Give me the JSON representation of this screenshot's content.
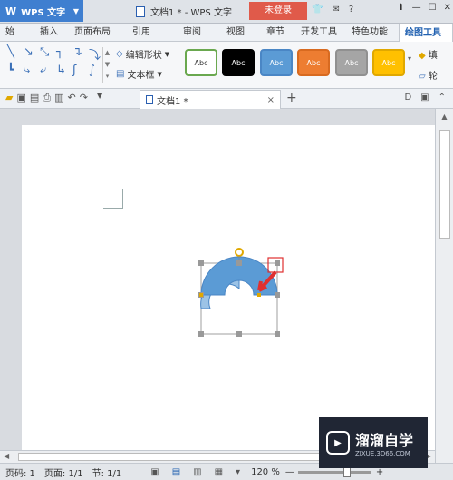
{
  "title_bar": {
    "app_name": "WPS 文字",
    "document_title": "文档1 * - WPS 文字",
    "login_label": "未登录"
  },
  "tabs": [
    "始",
    "插入",
    "页面布局",
    "引用",
    "审阅",
    "视图",
    "章节",
    "开发工具",
    "特色功能",
    "绘图工具"
  ],
  "active_tab": "绘图工具",
  "ribbon": {
    "edit_shape": "编辑形状",
    "text_box": "文本框",
    "style_label": "Abc",
    "styles": [
      {
        "bg": "#ffffff",
        "fg": "#333333",
        "border": "#6aa84f"
      },
      {
        "bg": "#000000",
        "fg": "#ffffff",
        "border": "#000000"
      },
      {
        "bg": "#5b9bd5",
        "fg": "#ffffff",
        "border": "#4a86c5"
      },
      {
        "bg": "#ed7d31",
        "fg": "#ffffff",
        "border": "#d86a20"
      },
      {
        "bg": "#a5a5a5",
        "fg": "#ffffff",
        "border": "#909090"
      },
      {
        "bg": "#ffc000",
        "fg": "#ffffff",
        "border": "#e0a800"
      }
    ],
    "right_fill": "填",
    "right_outline": "轮"
  },
  "doc_tab": {
    "label": "文档1 *"
  },
  "status_bar": {
    "page_num": "页码: 1",
    "pages": "页面: 1/1",
    "section": "节: 1/1",
    "zoom": "120 %"
  },
  "watermark": {
    "title": "溜溜自学",
    "url": "ZIXUE.3D66.COM"
  },
  "colors": {
    "accent": "#3f7fd0",
    "login": "#e05a4a",
    "arc": "#5b9bd5",
    "arc_light": "#9cc3e6",
    "arrow": "#e03030"
  }
}
